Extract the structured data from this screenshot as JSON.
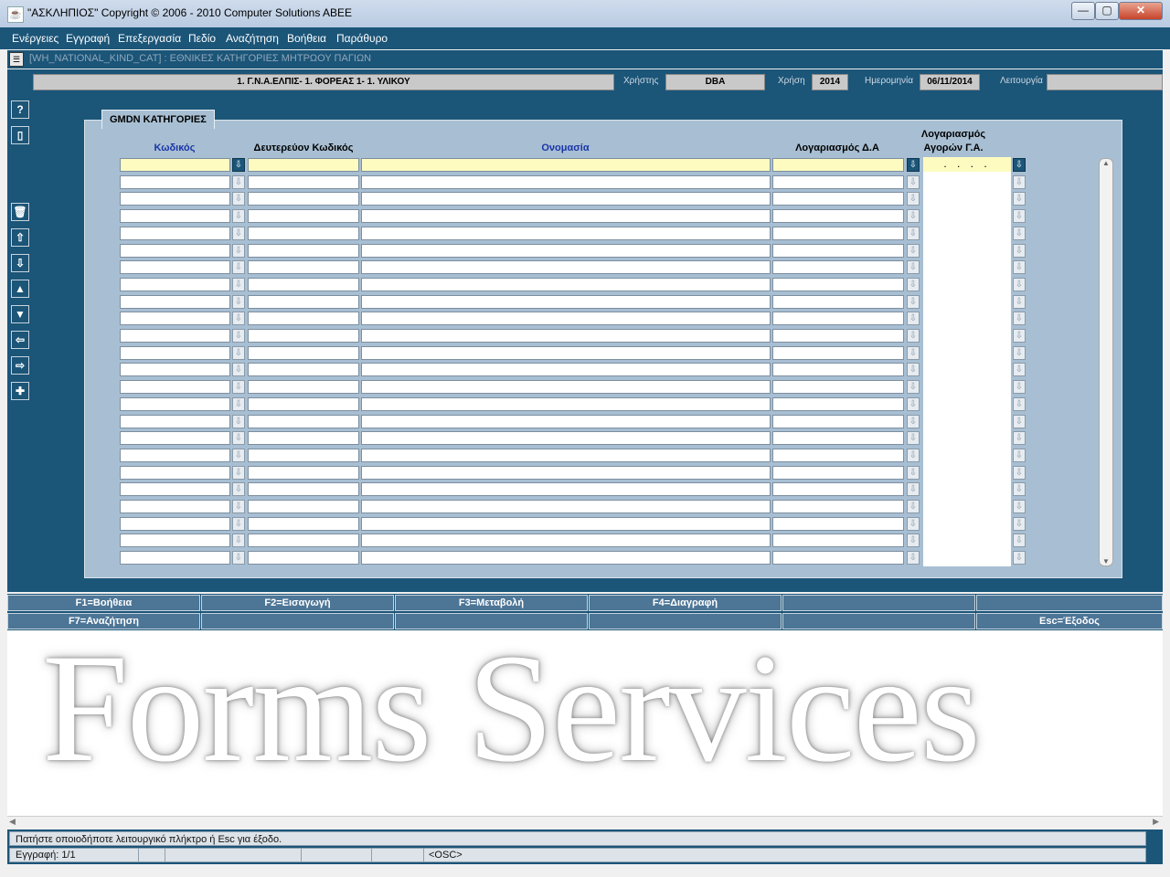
{
  "window": {
    "title": "\"ΑΣΚΛΗΠΙΟΣ\" Copyright © 2006 - 2010 Computer Solutions ABEE",
    "controls": [
      "—",
      "▢",
      "✕"
    ]
  },
  "menu": [
    "Ενέργειες",
    "Εγγραφή",
    "Επεξεργασία",
    "Πεδίο",
    "Αναζήτηση",
    "Βοήθεια",
    "Παράθυρο"
  ],
  "form": {
    "title": "[WH_NATIONAL_KIND_CAT]  :  ΕΘΝΙΚΕΣ ΚΑΤΗΓΟΡΙΕΣ ΜΗΤΡΩΟΥ ΠΑΓΙΩΝ"
  },
  "info": {
    "organization": "1. Γ.Ν.Α.ΕΛΠΙΣ- 1. ΦΟΡΕΑΣ 1- 1. ΥΛΙΚΟΥ",
    "user_label": "Χρήστης",
    "user_value": "DBA",
    "year_label": "Χρήση",
    "year_value": "2014",
    "date_label": "Ημερομηνία",
    "date_value": "06/11/2014",
    "function_label": "Λειτουργία",
    "function_value": ""
  },
  "sidebar": {
    "help_icon": "?",
    "book_icon": "book-icon",
    "buttons": [
      "trash-icon",
      "arrow-up-icon",
      "arrow-down-icon",
      "triangle-up-icon",
      "triangle-down-icon",
      "arrow-left-icon",
      "arrow-right-icon",
      "plus-icon"
    ]
  },
  "block": {
    "tab_label": "GMDN ΚΑΤΗΓΟΡΙΕΣ",
    "headers": {
      "code": "Κωδικός",
      "secondary_code": "Δευτερεύον Κωδικός",
      "name": "Ονομασία",
      "account_da": "Λογαριασμός Δ.Α",
      "account_ga_line1": "Λογαριασμός",
      "account_ga_line2": "Αγορών Γ.Α."
    },
    "first_row_ga_value": ". . . .",
    "row_count": 24,
    "current_row": 1
  },
  "function_keys": {
    "row1": [
      "F1=Βοήθεια",
      "F2=Εισαγωγή",
      "F3=Μεταβολή",
      "F4=Διαγραφή",
      "",
      ""
    ],
    "row2": [
      "F7=Αναζήτηση",
      "",
      "",
      "",
      "",
      "Esc=Έξοδος"
    ]
  },
  "watermark": "Forms Services",
  "status": {
    "message": "Πατήστε οποιοδήποτε λειτουργικό πλήκτρο ή Esc για έξοδο.",
    "record": "Εγγραφή: 1/1",
    "mode": "<OSC>"
  },
  "colors": {
    "background": "#1b5578",
    "panel": "#a8bfd3",
    "highlight": "#fdfbc0",
    "header_blue": "#1a35a8"
  }
}
